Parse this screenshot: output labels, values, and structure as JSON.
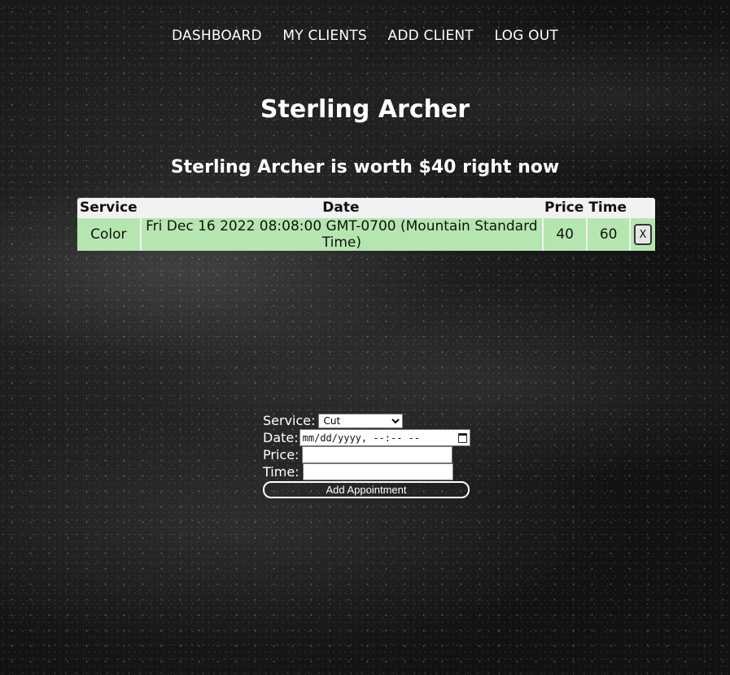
{
  "nav": {
    "dashboard": "DASHBOARD",
    "my_clients": "MY CLIENTS",
    "add_client": "ADD CLIENT",
    "log_out": "LOG OUT"
  },
  "client": {
    "name": "Sterling Archer",
    "worth_text": "Sterling Archer is worth $40 right now"
  },
  "table": {
    "headers": [
      "Service",
      "Date",
      "Price",
      "Time"
    ],
    "rows": [
      {
        "service": "Color",
        "date": "Fri Dec 16 2022 08:08:00 GMT-0700 (Mountain Standard Time)",
        "price": "40",
        "time": "60",
        "delete_label": "X"
      }
    ]
  },
  "form": {
    "service_label": "Service:",
    "service_selected": "Cut",
    "date_label": "Date:",
    "date_placeholder": "mm/dd/yyyy, --:-- --",
    "price_label": "Price:",
    "time_label": "Time:",
    "submit_label": "Add Appointment"
  },
  "icons": {
    "calendar": "calendar-icon"
  }
}
